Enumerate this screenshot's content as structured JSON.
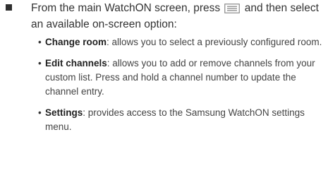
{
  "main_item": {
    "text_before_icon": "From the main WatchON screen, press",
    "icon": "menu-key-icon",
    "text_after_icon": "and then select an available on-screen option:"
  },
  "options": [
    {
      "label": "Change room",
      "description": ": allows you to select a previously configured room."
    },
    {
      "label": "Edit channels",
      "description": ": allows you to add or remove channels from your custom list. Press and hold a channel number to update the channel entry."
    },
    {
      "label": "Settings",
      "description": ": provides access to the Samsung WatchON settings menu."
    }
  ],
  "colors": {
    "text": "#333333",
    "icon": "#7a7a7a"
  }
}
